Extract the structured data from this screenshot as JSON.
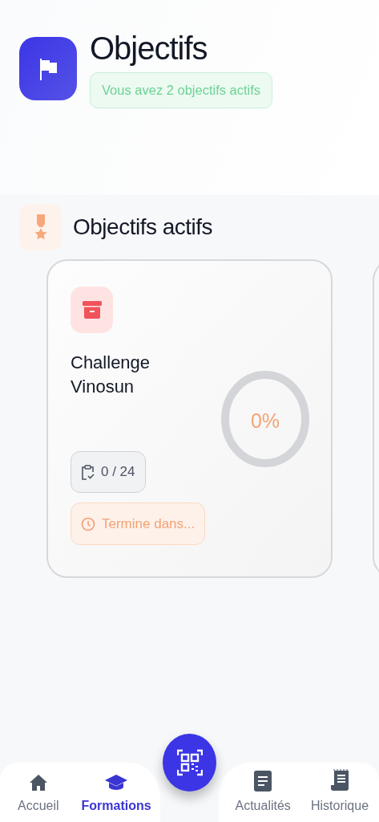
{
  "header": {
    "title": "Objectifs",
    "badge": "Vous avez 2 objectifs actifs"
  },
  "section": {
    "title": "Objectifs actifs"
  },
  "goals": [
    {
      "title": "Challenge Vinosun",
      "progress_text": "0%",
      "count": "0 / 24",
      "deadline": "Termine dans..."
    }
  ],
  "nav": [
    {
      "label": "Accueil",
      "selected": false
    },
    {
      "label": "Formations",
      "selected": true
    },
    {
      "label": "Actualités",
      "selected": false
    },
    {
      "label": "Historique",
      "selected": false
    }
  ]
}
